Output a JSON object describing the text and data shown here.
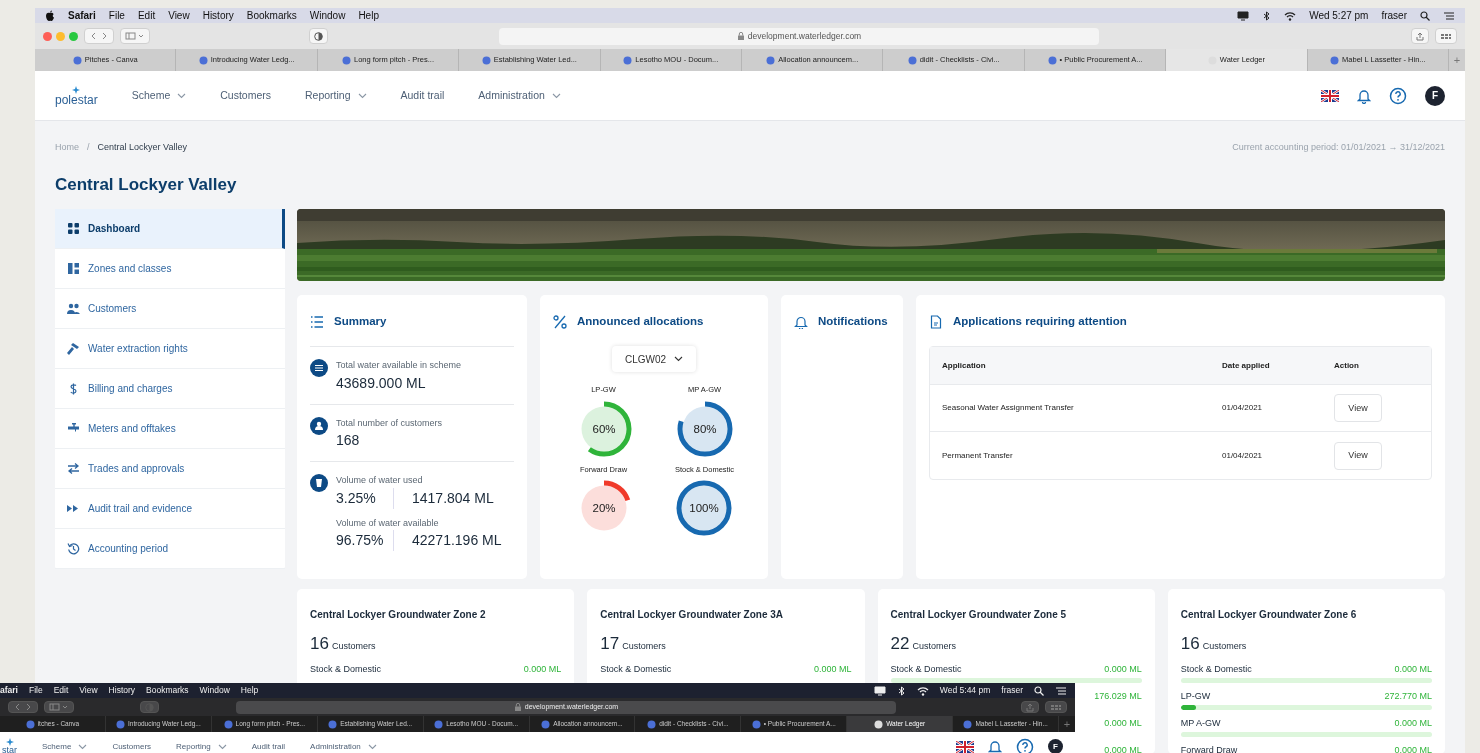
{
  "menu_bar": {
    "app": "Safari",
    "items": [
      "File",
      "Edit",
      "View",
      "History",
      "Bookmarks",
      "Window",
      "Help"
    ],
    "clock": "Wed 5:27 pm",
    "user": "fraser"
  },
  "browser": {
    "url": "development.waterledger.com",
    "tabs": [
      {
        "label": "Pitches - Canva",
        "selected": false
      },
      {
        "label": "Introducing Water Ledg...",
        "selected": false
      },
      {
        "label": "Long form pitch - Pres...",
        "selected": false
      },
      {
        "label": "Establishing Water Led...",
        "selected": false
      },
      {
        "label": "Lesotho MOU - Docum...",
        "selected": false
      },
      {
        "label": "Allocation announcem...",
        "selected": false
      },
      {
        "label": "didit - Checklists - Civi...",
        "selected": false
      },
      {
        "label": "• Public Procurement A...",
        "selected": false
      },
      {
        "label": "Water Ledger",
        "selected": true
      },
      {
        "label": "Mabel L Lassetter - Hin...",
        "selected": false
      }
    ],
    "new_tab": "+"
  },
  "navbar": {
    "logo": "polestar",
    "items": [
      {
        "label": "Scheme",
        "dropdown": true
      },
      {
        "label": "Customers",
        "dropdown": false
      },
      {
        "label": "Reporting",
        "dropdown": true
      },
      {
        "label": "Audit trail",
        "dropdown": false
      },
      {
        "label": "Administration",
        "dropdown": true
      }
    ],
    "avatar": "F"
  },
  "breadcrumb": {
    "items": [
      "Home",
      "Central Lockyer Valley"
    ],
    "separator": "/"
  },
  "accounting_period": "Current accounting period: 01/01/2021 → 31/12/2021",
  "title": "Central Lockyer Valley",
  "sidebar": {
    "items": [
      {
        "label": "Dashboard",
        "selected": true
      },
      {
        "label": "Zones and classes",
        "selected": false
      },
      {
        "label": "Customers",
        "selected": false
      },
      {
        "label": "Water extraction rights",
        "selected": false
      },
      {
        "label": "Billing and charges",
        "selected": false
      },
      {
        "label": "Meters and offtakes",
        "selected": false
      },
      {
        "label": "Trades and approvals",
        "selected": false
      },
      {
        "label": "Audit trail and evidence",
        "selected": false
      },
      {
        "label": "Accounting period",
        "selected": false
      }
    ]
  },
  "summary": {
    "title": "Summary",
    "stats": [
      {
        "label": "Total water available in scheme",
        "value": "43689.000 ML"
      },
      {
        "label": "Total number of customers",
        "value": "168"
      },
      {
        "label": "Volume of water used",
        "percent": "3.25%",
        "value": "1417.804 ML",
        "sub_label": "Volume of water available",
        "sub_percent": "96.75%",
        "sub_value": "42271.196 ML"
      }
    ]
  },
  "allocations": {
    "title": "Announced allocations",
    "select": "CLGW02",
    "gauges": [
      {
        "label": "LP-GW",
        "reading": "60%",
        "level": 0.6,
        "color": "#2fb43a"
      },
      {
        "label": "MP A-GW",
        "reading": "80%",
        "level": 0.8,
        "color": "#1769b0"
      },
      {
        "label": "Forward Draw",
        "reading": "20%",
        "level": 0.2,
        "color": "#f03a2a"
      },
      {
        "label": "Stock & Domestic",
        "reading": "100%",
        "level": 1,
        "color": "#1769b0"
      }
    ]
  },
  "notifications": {
    "title": "Notifications"
  },
  "applications": {
    "title": "Applications requiring attention",
    "columns": [
      "Application",
      "Date applied",
      "Action"
    ],
    "rows": [
      {
        "application": "Seasonal Water Assignment Transfer",
        "date": "01/04/2021",
        "action": "View"
      },
      {
        "application": "Permanent Transfer",
        "date": "01/04/2021",
        "action": "View"
      }
    ]
  },
  "zones": [
    {
      "name": "Central Lockyer Groundwater Zone 2",
      "count": "16",
      "unit": "Customers",
      "rows": [
        {
          "label": "Stock & Domestic",
          "value": "0.000 ML"
        }
      ]
    },
    {
      "name": "Central Lockyer Groundwater Zone 3A",
      "count": "17",
      "unit": "Customers",
      "rows": [
        {
          "label": "Stock & Domestic",
          "value": "0.000 ML"
        }
      ]
    },
    {
      "name": "Central Lockyer Groundwater Zone 5",
      "count": "22",
      "unit": "Customers",
      "rows": [
        {
          "label": "Stock & Domestic",
          "value": "0.000 ML",
          "level": 0
        },
        {
          "value": "176.029 ML"
        },
        {
          "value": "0.000 ML"
        },
        {
          "value": "0.000 ML"
        }
      ]
    },
    {
      "name": "Central Lockyer Groundwater Zone 6",
      "count": "16",
      "unit": "Customers",
      "rows": [
        {
          "label": "Stock & Domestic",
          "value": "0.000 ML",
          "level": 0
        },
        {
          "label": "LP-GW",
          "value": "272.770 ML",
          "level": 0.06
        },
        {
          "label": "MP A-GW",
          "value": "0.000 ML",
          "level": 0
        },
        {
          "label": "Forward Draw",
          "value": "0.000 ML"
        }
      ]
    }
  ],
  "second_screenshot": {
    "menu_bar": {
      "app": "afari",
      "items": [
        "File",
        "Edit",
        "View",
        "History",
        "Bookmarks",
        "Window",
        "Help"
      ],
      "clock": "Wed 5:44 pm",
      "user": "fraser"
    },
    "browser": {
      "url": "development.waterledger.com",
      "tabs": [
        {
          "label": "itches - Canva",
          "selected": false
        },
        {
          "label": "Introducing Water Ledg...",
          "selected": false
        },
        {
          "label": "Long form pitch - Pres...",
          "selected": false
        },
        {
          "label": "Establishing Water Led...",
          "selected": false
        },
        {
          "label": "Lesotho MOU - Docum...",
          "selected": false
        },
        {
          "label": "Allocation announcem...",
          "selected": false
        },
        {
          "label": "didit - Checklists - Civi...",
          "selected": false
        },
        {
          "label": "• Public Procurement A...",
          "selected": false
        },
        {
          "label": "Water Ledger",
          "selected": true
        },
        {
          "label": "Mabel L Lassetter - Hin...",
          "selected": false
        }
      ],
      "new_tab": "+"
    },
    "navbar": {
      "logo": "star",
      "items": [
        {
          "label": "Scheme",
          "dropdown": true
        },
        {
          "label": "Customers",
          "dropdown": false
        },
        {
          "label": "Reporting",
          "dropdown": true
        },
        {
          "label": "Audit trail",
          "dropdown": false
        },
        {
          "label": "Administration",
          "dropdown": true
        }
      ],
      "avatar": "F"
    }
  }
}
